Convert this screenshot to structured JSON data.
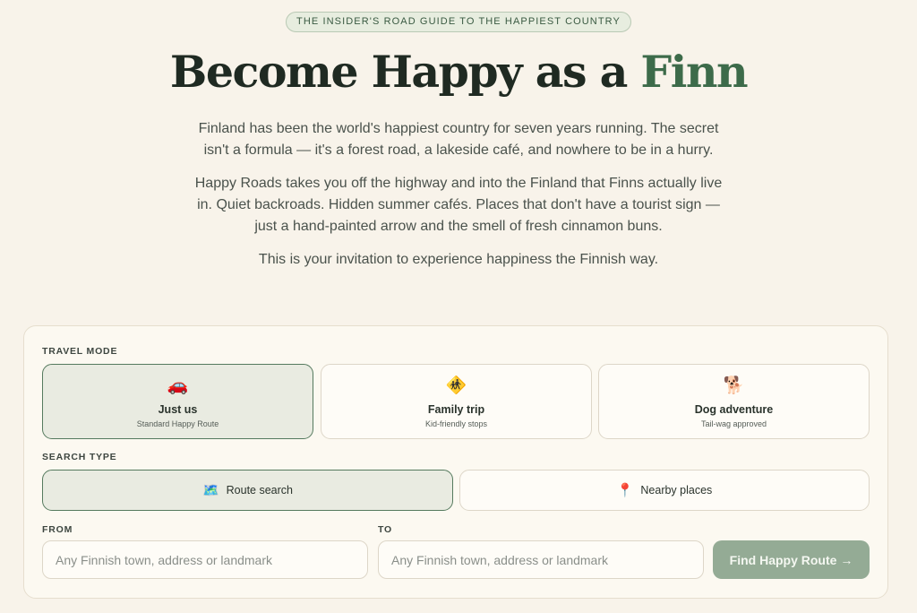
{
  "hero": {
    "eyebrow": "THE INSIDER'S ROAD GUIDE TO THE HAPPIEST COUNTRY",
    "title_main": "Become Happy as a ",
    "title_accent": "Finn",
    "paragraphs": [
      "Finland has been the world's happiest country for seven years running. The secret isn't a formula — it's a forest road, a lakeside café, and nowhere to be in a hurry.",
      "Happy Roads takes you off the highway and into the Finland that Finns actually live in. Quiet backroads. Hidden summer cafés. Places that don't have a tourist sign — just a hand-painted arrow and the smell of fresh cinnamon buns.",
      "This is your invitation to experience happiness the Finnish way."
    ]
  },
  "planner": {
    "travel_mode_label": "TRAVEL MODE",
    "modes": [
      {
        "icon": "🚗",
        "icon_name": "car-icon",
        "title": "Just us",
        "subtitle": "Standard Happy Route",
        "selected": true
      },
      {
        "icon": "🚸",
        "icon_name": "family-icon",
        "title": "Family trip",
        "subtitle": "Kid-friendly stops",
        "selected": false
      },
      {
        "icon": "🐕",
        "icon_name": "dog-icon",
        "title": "Dog adventure",
        "subtitle": "Tail-wag approved",
        "selected": false
      }
    ],
    "search_type_label": "SEARCH TYPE",
    "search_types": [
      {
        "icon": "🗺️",
        "icon_name": "map-icon",
        "label": "Route search",
        "selected": true
      },
      {
        "icon": "📍",
        "icon_name": "pin-icon",
        "label": "Nearby places",
        "selected": false
      }
    ],
    "from_label": "FROM",
    "from_placeholder": "Any Finnish town, address or landmark",
    "to_label": "TO",
    "to_placeholder": "Any Finnish town, address or landmark",
    "submit_label": "Find Happy Route →"
  },
  "colors": {
    "background": "#f8f3ea",
    "accent_green": "#3d6b4a",
    "button_green": "#94ab95",
    "selected_bg": "#e9ebe1"
  }
}
